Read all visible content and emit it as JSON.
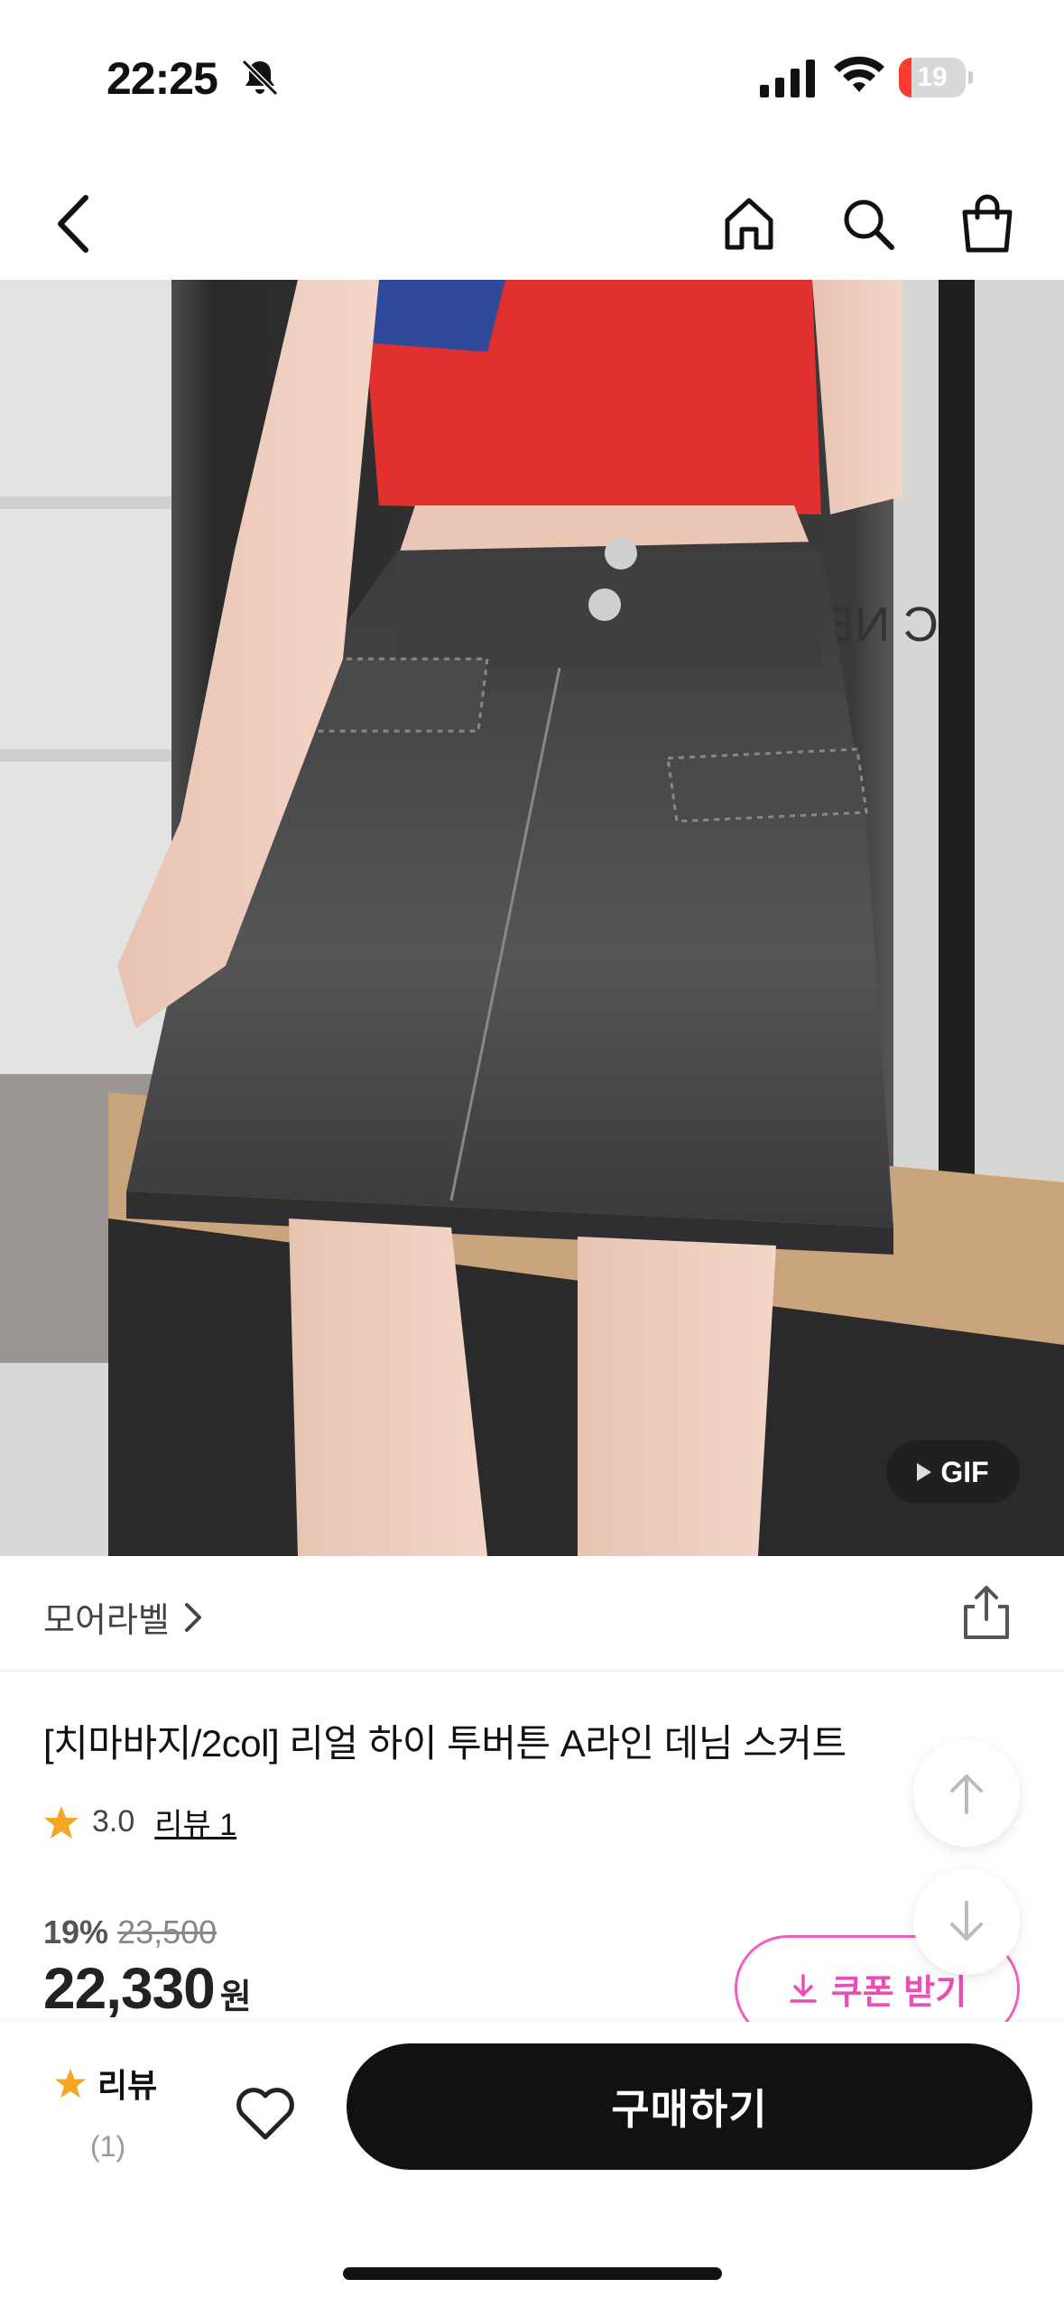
{
  "status_bar": {
    "time": "22:25",
    "battery_level": "19",
    "battery_fraction": 0.19,
    "icons": [
      "bell-slash-icon",
      "signal-icon",
      "wifi-icon",
      "battery-icon"
    ]
  },
  "nav": {
    "icons": [
      "back-chevron-icon",
      "home-icon",
      "search-icon",
      "shopping-bag-icon"
    ]
  },
  "media": {
    "gif_label": "GIF",
    "image_description_icon": "product-photo"
  },
  "brand": {
    "name": "모어라벨",
    "chevron": "›"
  },
  "product": {
    "title": "[치마바지/2col] 리얼 하이 투버튼 A라인 데님 스커트",
    "rating": "3.0",
    "review_link": "리뷰 1",
    "discount": "19%",
    "original_price": "23,500",
    "price": "22,330",
    "currency": "원"
  },
  "coupon": {
    "label": "쿠폰 받기"
  },
  "bottom_bar": {
    "review_label": "리뷰",
    "review_count": "(1)",
    "buy_label": "구매하기"
  },
  "colors": {
    "accent_pink": "#e750b2",
    "star": "#f5a623",
    "buy_button": "#111111",
    "battery_low": "#ff3b30"
  }
}
